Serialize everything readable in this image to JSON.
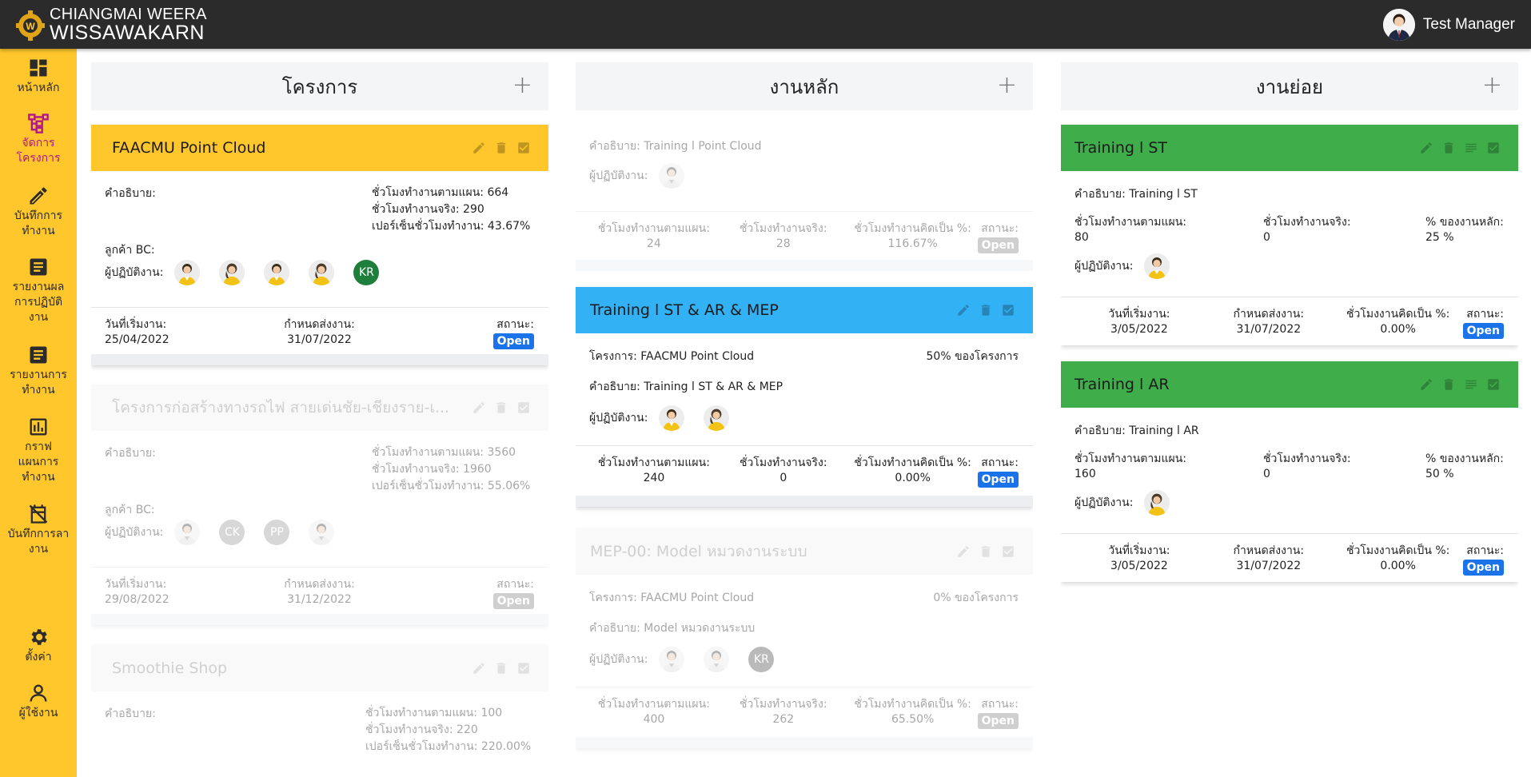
{
  "header": {
    "logo_line1": "CHIANGMAI WEERA",
    "logo_line2": "WISSAWAKARN",
    "user_name": "Test Manager"
  },
  "sidebar": {
    "items": [
      {
        "label": "หน้าหลัก",
        "icon": "dashboard-icon"
      },
      {
        "label": "จัดการโครงการ",
        "icon": "sitemap-icon",
        "active": true
      },
      {
        "label": "บันทึกการทำงาน",
        "icon": "pencil-icon"
      },
      {
        "label": "รายงานผลการปฏิบัติงาน",
        "icon": "report-icon"
      },
      {
        "label": "รายงานการทำงาน",
        "icon": "report-icon"
      },
      {
        "label": "กราฟแผนการทำงาน",
        "icon": "chart-icon"
      },
      {
        "label": "บันทึกการลางาน",
        "icon": "calendar-off-icon"
      },
      {
        "label": "ตั้งค่า",
        "icon": "gear-icon"
      },
      {
        "label": "ผู้ใช้งาน",
        "icon": "user-icon"
      }
    ]
  },
  "labels": {
    "desc": "คำอธิบาย:",
    "client": "ลูกค้า BC:",
    "assignee": "ผู้ปฏิบัติงาน:",
    "planned_hours": "ชั่วโมงทำงานตามแผน:",
    "actual_hours": "ชั่วโมงทำงานจริง:",
    "hours_percent": "เปอร์เซ็นชั่วโมงทำงาน:",
    "start_date": "วันที่เริ่มงาน:",
    "deadline": "กำหนดส่งงาน:",
    "status": "สถานะ:",
    "percent_done": "ชั่วโมงทำงานคิดเป็น %:",
    "percent_done_sub": "ชั่วโมงงานคิดเป็น %:",
    "of_main": "% ของงานหลัก:",
    "project": "โครงการ:"
  },
  "columns": {
    "projects": {
      "title": "โครงการ",
      "add": "+",
      "cards": [
        {
          "title": "FAACMU Point Cloud",
          "desc": "คำอธิบาย:",
          "planned": "ชั่วโมงทำงานตามแผน: 664",
          "actual": "ชั่วโมงทำงานจริง: 290",
          "percent": "เปอร์เซ็นชั่วโมงทำงาน: 43.67%",
          "client": "ลูกค้า BC:",
          "start": "25/04/2022",
          "deadline": "31/07/2022",
          "status": "Open",
          "initials": "KR"
        },
        {
          "title": "โครงการก่อสร้างทางรถไฟ สายเด่นชัย-เชียงราย-เ...",
          "desc": "คำอธิบาย:",
          "planned": "ชั่วโมงทำงานตามแผน: 3560",
          "actual": "ชั่วโมงทำงานจริง: 1960",
          "percent": "เปอร์เซ็นชั่วโมงทำงาน: 55.06%",
          "client": "ลูกค้า BC:",
          "start": "29/08/2022",
          "deadline": "31/12/2022",
          "status": "Open",
          "initials1": "CK",
          "initials2": "PP"
        },
        {
          "title": "Smoothie Shop",
          "desc": "คำอธิบาย:",
          "planned": "ชั่วโมงทำงานตามแผน: 100",
          "actual": "ชั่วโมงทำงานจริง: 220",
          "percent": "เปอร์เซ็นชั่วโมงทำงาน: 220.00%"
        }
      ]
    },
    "main_tasks": {
      "title": "งานหลัก",
      "add": "+",
      "cards": [
        {
          "desc": "คำอธิบาย: Training l Point Cloud",
          "planned": "24",
          "actual": "28",
          "percent": "116.67%",
          "status": "Open"
        },
        {
          "title": "Training l ST & AR & MEP",
          "project": "โครงการ: FAACMU Point Cloud",
          "share": "50% ของโครงการ",
          "desc": "คำอธิบาย: Training l ST & AR & MEP",
          "planned": "240",
          "actual": "0",
          "percent": "0.00%",
          "status": "Open"
        },
        {
          "title": "MEP-00: Model หมวดงานระบบ",
          "project": "โครงการ: FAACMU Point Cloud",
          "share": "0% ของโครงการ",
          "desc": "คำอธิบาย: Model หมวดงานระบบ",
          "planned": "400",
          "actual": "262",
          "percent": "65.50%",
          "status": "Open",
          "initials": "KR"
        }
      ]
    },
    "sub_tasks": {
      "title": "งานย่อย",
      "add": "+",
      "cards": [
        {
          "title": "Training l ST",
          "desc": "คำอธิบาย: Training l ST",
          "planned": "80",
          "actual": "0",
          "share": "25 %",
          "start": "3/05/2022",
          "deadline": "31/07/2022",
          "percent": "0.00%",
          "status": "Open"
        },
        {
          "title": "Training l AR",
          "desc": "คำอธิบาย: Training l AR",
          "planned": "160",
          "actual": "0",
          "share": "50 %",
          "start": "3/05/2022",
          "deadline": "31/07/2022",
          "percent": "0.00%",
          "status": "Open"
        }
      ]
    }
  },
  "colors": {
    "sidebar": "#ffc72c",
    "topbar": "#2b2b2b",
    "active_nav": "#b3138c",
    "project_header": "#ffc72c",
    "main_header": "#33b1f5",
    "sub_header": "#3fae4a",
    "badge": "#1a73e8"
  }
}
